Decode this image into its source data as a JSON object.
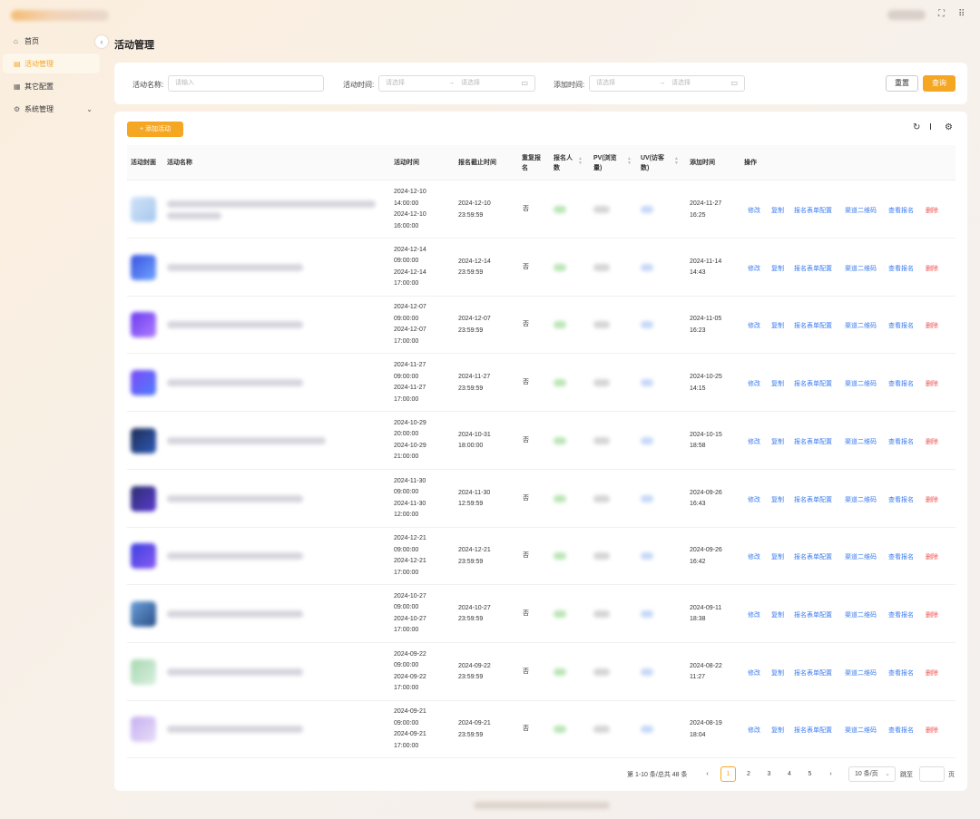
{
  "sidebar": {
    "items": [
      {
        "label": "首页",
        "icon": "home-icon"
      },
      {
        "label": "活动管理",
        "icon": "document-icon",
        "active": true
      },
      {
        "label": "其它配置",
        "icon": "grid-icon"
      },
      {
        "label": "系统管理",
        "icon": "gear-icon"
      }
    ]
  },
  "page": {
    "title": "活动管理"
  },
  "filters": {
    "name_label": "活动名称:",
    "name_placeholder": "请输入",
    "time_label": "活动时间:",
    "add_time_label": "添加时间:",
    "date_placeholder": "请选择",
    "range_sep": "→",
    "reset_label": "重置",
    "search_label": "查询"
  },
  "toolbar": {
    "add_label": "+ 添加活动"
  },
  "table": {
    "columns": [
      "活动封面",
      "活动名称",
      "活动时间",
      "报名截止时间",
      "重复报名",
      "报名人数",
      "PV(浏览量)",
      "UV(访客数)",
      "添加时间",
      "操作"
    ],
    "actions": [
      "修改",
      "复制",
      "报名表单配置",
      "渠道二维码",
      "查看报名",
      "删除"
    ],
    "rows": [
      {
        "time": [
          "2024-12-10",
          "14:00:00",
          "2024-12-10",
          "16:00:00"
        ],
        "deadline": [
          "2024-12-10",
          "23:59:59"
        ],
        "repeat": "否",
        "added": [
          "2024-11-27",
          "16:25"
        ]
      },
      {
        "time": [
          "2024-12-14",
          "09:00:00",
          "2024-12-14",
          "17:00:00"
        ],
        "deadline": [
          "2024-12-14",
          "23:59:59"
        ],
        "repeat": "否",
        "added": [
          "2024-11-14",
          "14:43"
        ]
      },
      {
        "time": [
          "2024-12-07",
          "09:00:00",
          "2024-12-07",
          "17:00:00"
        ],
        "deadline": [
          "2024-12-07",
          "23:59:59"
        ],
        "repeat": "否",
        "added": [
          "2024-11-05",
          "16:23"
        ]
      },
      {
        "time": [
          "2024-11-27",
          "09:00:00",
          "2024-11-27",
          "17:00:00"
        ],
        "deadline": [
          "2024-11-27",
          "23:59:59"
        ],
        "repeat": "否",
        "added": [
          "2024-10-25",
          "14:15"
        ]
      },
      {
        "time": [
          "2024-10-29",
          "20:00:00",
          "2024-10-29",
          "21:00:00"
        ],
        "deadline": [
          "2024-10-31",
          "18:00:00"
        ],
        "repeat": "否",
        "added": [
          "2024-10-15",
          "18:58"
        ]
      },
      {
        "time": [
          "2024-11-30",
          "09:00:00",
          "2024-11-30",
          "12:00:00"
        ],
        "deadline": [
          "2024-11-30",
          "12:59:59"
        ],
        "repeat": "否",
        "added": [
          "2024-09-26",
          "16:43"
        ]
      },
      {
        "time": [
          "2024-12-21",
          "09:00:00",
          "2024-12-21",
          "17:00:00"
        ],
        "deadline": [
          "2024-12-21",
          "23:59:59"
        ],
        "repeat": "否",
        "added": [
          "2024-09-26",
          "16:42"
        ]
      },
      {
        "time": [
          "2024-10-27",
          "09:00:00",
          "2024-10-27",
          "17:00:00"
        ],
        "deadline": [
          "2024-10-27",
          "23:59:59"
        ],
        "repeat": "否",
        "added": [
          "2024-09-11",
          "18:38"
        ]
      },
      {
        "time": [
          "2024-09-22",
          "09:00:00",
          "2024-09-22",
          "17:00:00"
        ],
        "deadline": [
          "2024-09-22",
          "23:59:59"
        ],
        "repeat": "否",
        "added": [
          "2024-08-22",
          "11:27"
        ]
      },
      {
        "time": [
          "2024-09-21",
          "09:00:00",
          "2024-09-21",
          "17:00:00"
        ],
        "deadline": [
          "2024-09-21",
          "23:59:59"
        ],
        "repeat": "否",
        "added": [
          "2024-08-19",
          "18:04"
        ]
      }
    ]
  },
  "pagination": {
    "summary": "第 1-10 条/总共 48 条",
    "pages": [
      "1",
      "2",
      "3",
      "4",
      "5"
    ],
    "current": "1",
    "prev": "‹",
    "next": "›",
    "page_size": "10 条/页",
    "jump_label": "跳至",
    "page_unit": "页"
  },
  "colors": {
    "accent": "#f5a623",
    "link": "#3a7bf0",
    "danger": "#ef4f4f"
  }
}
